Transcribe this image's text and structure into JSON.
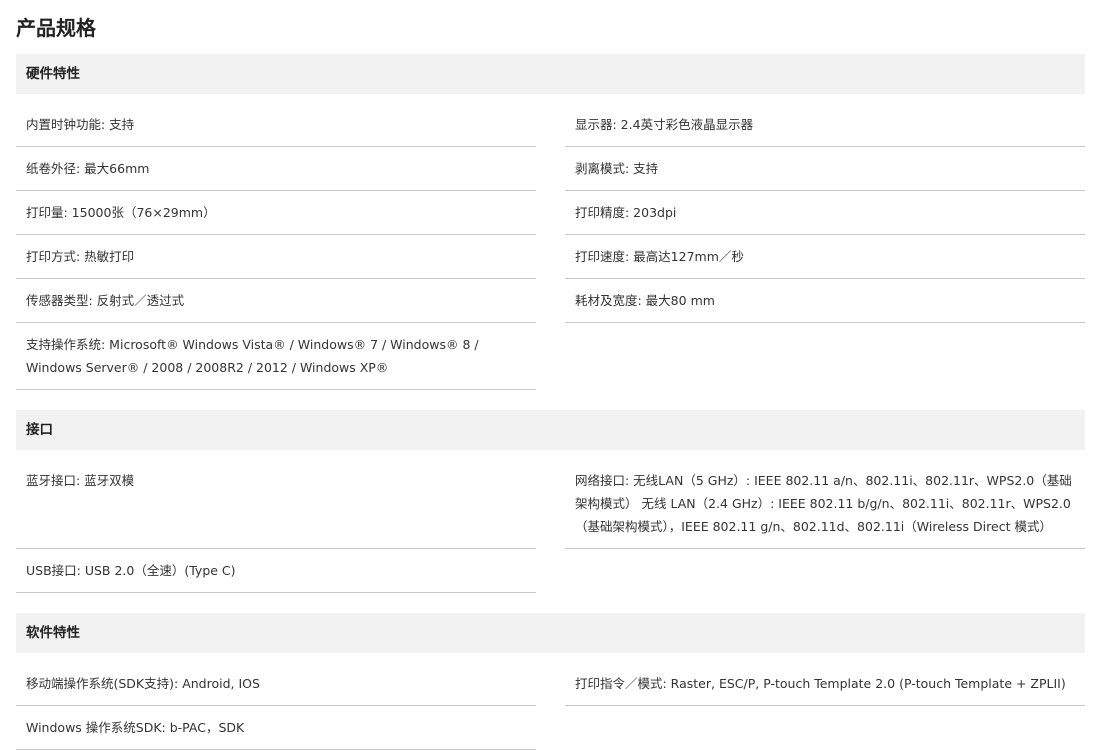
{
  "title": "产品规格",
  "sections": [
    {
      "heading": "硬件特性",
      "rows": [
        [
          "内置时钟功能: 支持",
          "显示器: 2.4英寸彩色液晶显示器"
        ],
        [
          "纸卷外径: 最大66mm",
          "剥离模式: 支持"
        ],
        [
          "打印量: 15000张（76×29mm）",
          "打印精度: 203dpi"
        ],
        [
          "打印方式: 热敏打印",
          "打印速度: 最高达127mm／秒"
        ],
        [
          "传感器类型: 反射式／透过式",
          "耗材及宽度: 最大80 mm"
        ],
        [
          "支持操作系统: Microsoft® Windows Vista® / Windows® 7 / Windows® 8 / Windows Server® / 2008 / 2008R2 / 2012 / Windows XP®",
          ""
        ]
      ]
    },
    {
      "heading": "接口",
      "rows": [
        [
          "蓝牙接口: 蓝牙双模",
          "网络接口: 无线LAN（5 GHz）: IEEE 802.11 a/n、802.11i、802.11r、WPS2.0（基础架构模式） 无线 LAN（2.4 GHz）: IEEE 802.11 b/g/n、802.11i、802.11r、WPS2.0（基础架构模式），IEEE 802.11 g/n、802.11d、802.11i（Wireless Direct 模式）"
        ],
        [
          "USB接口: USB 2.0（全速）(Type C)",
          ""
        ]
      ]
    },
    {
      "heading": "软件特性",
      "rows": [
        [
          "移动端操作系统(SDK支持): Android, IOS",
          "打印指令／模式: Raster, ESC/P, P-touch Template 2.0 (P-touch Template + ZPLII)"
        ],
        [
          "Windows 操作系统SDK: b-PAC，SDK",
          ""
        ]
      ]
    }
  ]
}
